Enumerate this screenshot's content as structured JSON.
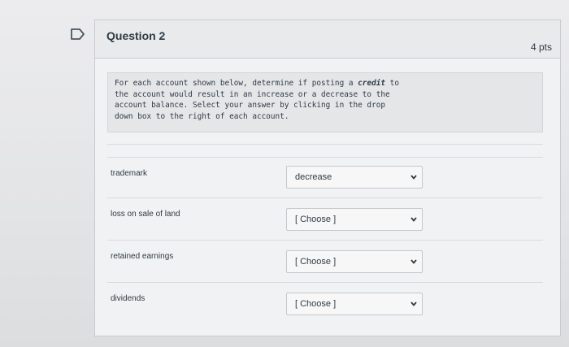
{
  "question": {
    "title": "Question 2",
    "points": "4 pts",
    "instructions": {
      "line1_pre": "For each account shown below, determine if posting a ",
      "line1_bold": "credit",
      "line1_post": " to",
      "line2": "the account would result in an increase or a decrease to the",
      "line3": "account balance. Select your answer by clicking in the drop",
      "line4": "down box to the right of each account."
    },
    "rows": [
      {
        "label": "trademark",
        "selected": "decrease"
      },
      {
        "label": "loss on sale of land",
        "selected": "[ Choose ]"
      },
      {
        "label": "retained earnings",
        "selected": "[ Choose ]"
      },
      {
        "label": "dividends",
        "selected": "[ Choose ]"
      }
    ]
  },
  "icons": {
    "flag": "flag-icon",
    "dropdown": "chevron-down-icon"
  },
  "colors": {
    "text": "#2d3b45",
    "border": "#c7cbcf"
  }
}
